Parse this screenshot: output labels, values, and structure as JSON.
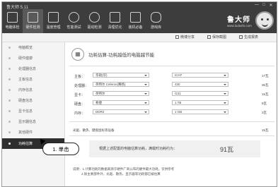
{
  "app": {
    "title": "鲁大师 5.11"
  },
  "window_controls": [
    "—",
    "□",
    "✕"
  ],
  "nav": [
    {
      "label": "电脑体检"
    },
    {
      "label": "硬件检测"
    },
    {
      "label": "温度管理"
    },
    {
      "label": "性能测试"
    },
    {
      "label": "驱动检测"
    },
    {
      "label": "清理优化"
    },
    {
      "label": "装机必备"
    },
    {
      "label": "游戏库"
    }
  ],
  "brand": {
    "name": "鲁大师",
    "tagline": "www.ludashi.com"
  },
  "toolbar": {
    "share": "微博分享",
    "save": "保存截图",
    "report": "生成报表"
  },
  "sidebar": {
    "items": [
      {
        "label": "电脑概览"
      },
      {
        "label": "硬件健康"
      },
      {
        "label": "处理器信息"
      },
      {
        "label": "主板信息"
      },
      {
        "label": "内存信息"
      },
      {
        "label": "硬盘信息"
      },
      {
        "label": "显卡信息"
      },
      {
        "label": "显示器信息"
      },
      {
        "label": "其他硬件"
      },
      {
        "label": "功耗估算"
      }
    ]
  },
  "callout": {
    "text": "1. 单击"
  },
  "page": {
    "title": "功耗估算-功耗越低的电脑越节能"
  },
  "config": [
    {
      "label": "主板：",
      "brand": "华硕(华)",
      "model": "ICH7",
      "power": "17瓦"
    },
    {
      "label": "处理器：",
      "brand": "英特尔 Celeron(赛扬)",
      "model": "430",
      "power": "35瓦"
    },
    {
      "label": "显卡：",
      "brand": "英特尔",
      "model": "G31",
      "power": "15瓦"
    },
    {
      "label": "硬盘：",
      "brand": "希捷",
      "model": "1 TB",
      "power": "9瓦"
    },
    {
      "label": "内存：",
      "brand": "DDR2",
      "model": "1 GB",
      "power": "3瓦"
    }
  ],
  "summary": {
    "label": "光驱、散热、键盘鼠标等设备",
    "power": "15瓦"
  },
  "total": {
    "label": "根据上述配置的电脑估算功耗，满载时功耗约为：",
    "value": "91瓦"
  },
  "notes": [
    "说明：1.计算功耗的数据来源于硬件厂商公布的硬件最大功耗，仅供参考",
    "2.除主要部件外，光驱、散热、显示器等功耗都已被估算"
  ]
}
